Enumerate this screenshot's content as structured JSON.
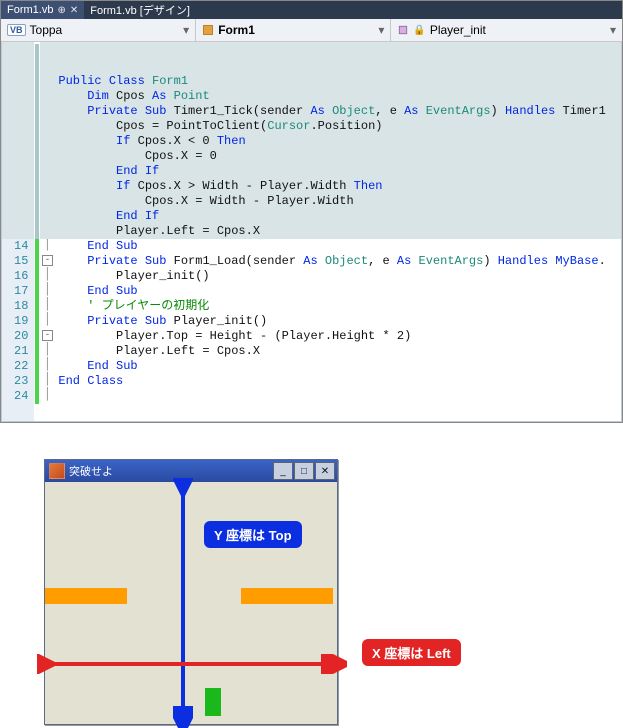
{
  "tabs": [
    {
      "label": "Form1.vb",
      "active": true
    },
    {
      "label": "Form1.vb [デザイン]",
      "active": false
    }
  ],
  "nav": {
    "scope": "Toppa",
    "class": "Form1",
    "member": "Player_init"
  },
  "lineCount": 24,
  "folds": {
    "1": "-",
    "4": "-",
    "6": "-",
    "9": "-",
    "15": "-",
    "20": "-"
  },
  "changeBars": [
    {
      "from": 1,
      "to": 13,
      "color": "#a8c8c8"
    },
    {
      "from": 14,
      "to": 24,
      "color": "#4ad64a"
    }
  ],
  "highlightFrom": 1,
  "highlightTo": 13,
  "code": [
    [
      [
        "kw",
        "Public Class"
      ],
      [
        "black",
        " "
      ],
      [
        "type",
        "Form1"
      ]
    ],
    [
      [
        "black",
        "    "
      ],
      [
        "kw",
        "Dim"
      ],
      [
        "black",
        " Cpos "
      ],
      [
        "kw",
        "As"
      ],
      [
        "black",
        " "
      ],
      [
        "type",
        "Point"
      ]
    ],
    [
      [
        "black",
        ""
      ]
    ],
    [
      [
        "black",
        "    "
      ],
      [
        "kw",
        "Private Sub"
      ],
      [
        "black",
        " Timer1_Tick(sender "
      ],
      [
        "kw",
        "As"
      ],
      [
        "black",
        " "
      ],
      [
        "type",
        "Object"
      ],
      [
        "black",
        ", e "
      ],
      [
        "kw",
        "As"
      ],
      [
        "black",
        " "
      ],
      [
        "type",
        "EventArgs"
      ],
      [
        "black",
        ") "
      ],
      [
        "kw",
        "Handles"
      ],
      [
        "black",
        " Timer1"
      ]
    ],
    [
      [
        "black",
        "        Cpos = PointToClient("
      ],
      [
        "type",
        "Cursor"
      ],
      [
        "black",
        ".Position)"
      ]
    ],
    [
      [
        "black",
        "        "
      ],
      [
        "kw",
        "If"
      ],
      [
        "black",
        " Cpos.X < 0 "
      ],
      [
        "kw",
        "Then"
      ]
    ],
    [
      [
        "black",
        "            Cpos.X = 0"
      ]
    ],
    [
      [
        "black",
        "        "
      ],
      [
        "kw",
        "End If"
      ]
    ],
    [
      [
        "black",
        "        "
      ],
      [
        "kw",
        "If"
      ],
      [
        "black",
        " Cpos.X > Width - Player.Width "
      ],
      [
        "kw",
        "Then"
      ]
    ],
    [
      [
        "black",
        "            Cpos.X = Width - Player.Width"
      ]
    ],
    [
      [
        "black",
        "        "
      ],
      [
        "kw",
        "End If"
      ]
    ],
    [
      [
        "black",
        "        Player.Left = Cpos.X"
      ]
    ],
    [
      [
        "black",
        "    "
      ],
      [
        "kw",
        "End Sub"
      ]
    ],
    [
      [
        "black",
        ""
      ]
    ],
    [
      [
        "black",
        "    "
      ],
      [
        "kw",
        "Private Sub"
      ],
      [
        "black",
        " Form1_Load(sender "
      ],
      [
        "kw",
        "As"
      ],
      [
        "black",
        " "
      ],
      [
        "type",
        "Object"
      ],
      [
        "black",
        ", e "
      ],
      [
        "kw",
        "As"
      ],
      [
        "black",
        " "
      ],
      [
        "type",
        "EventArgs"
      ],
      [
        "black",
        ") "
      ],
      [
        "kw",
        "Handles"
      ],
      [
        "black",
        " "
      ],
      [
        "kw",
        "MyBase"
      ],
      [
        "black",
        "."
      ]
    ],
    [
      [
        "black",
        "        Player_init()"
      ]
    ],
    [
      [
        "black",
        "    "
      ],
      [
        "kw",
        "End Sub"
      ]
    ],
    [
      [
        "black",
        ""
      ]
    ],
    [
      [
        "black",
        "    "
      ],
      [
        "cmt",
        "' プレイヤーの初期化"
      ]
    ],
    [
      [
        "black",
        "    "
      ],
      [
        "kw",
        "Private Sub"
      ],
      [
        "black",
        " Player_init()"
      ]
    ],
    [
      [
        "black",
        "        Player.Top = Height - (Player.Height * 2)"
      ]
    ],
    [
      [
        "black",
        "        Player.Left = Cpos.X"
      ]
    ],
    [
      [
        "black",
        "    "
      ],
      [
        "kw",
        "End Sub"
      ]
    ],
    [
      [
        "kw",
        "End Class"
      ]
    ]
  ],
  "form": {
    "title": "突破せよ",
    "labelY": "Y 座標は Top",
    "labelX": "X 座標は Left"
  }
}
